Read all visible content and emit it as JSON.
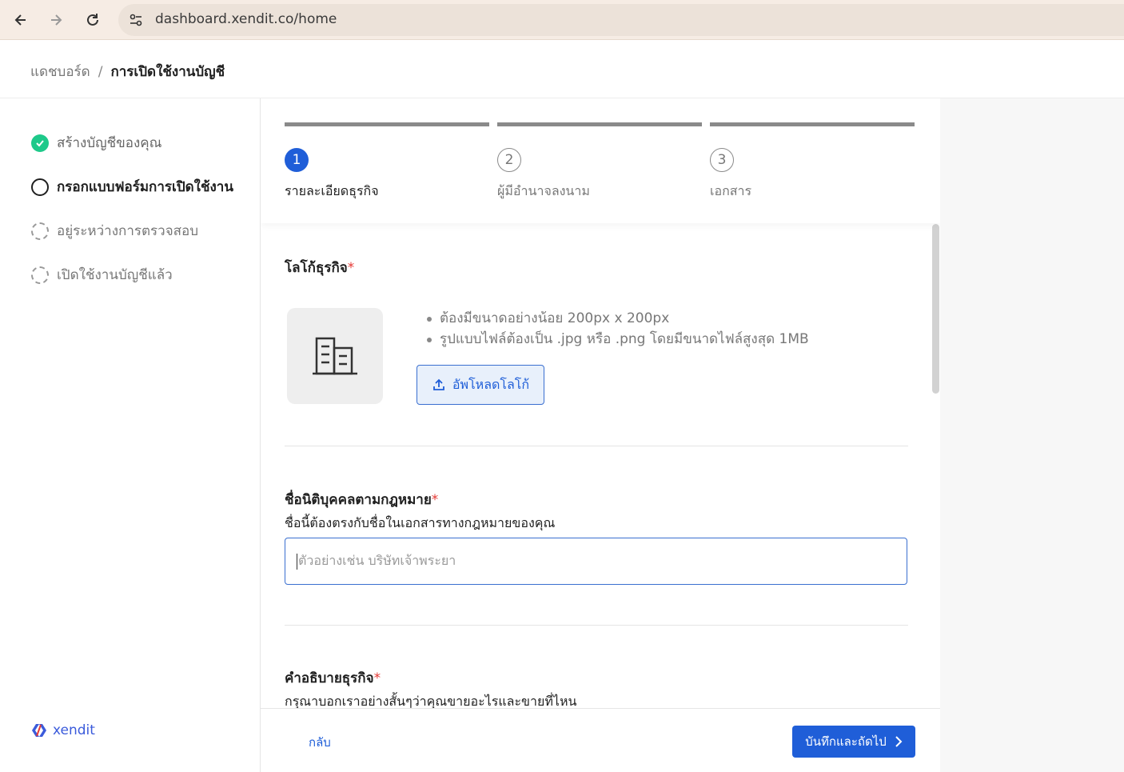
{
  "browser": {
    "url": "dashboard.xendit.co/home"
  },
  "breadcrumb": {
    "home": "แดชบอร์ด",
    "separator": "/",
    "current": "การเปิดใช้งานบัญชี"
  },
  "sidebar": {
    "steps": [
      {
        "label": "สร้างบัญชีของคุณ",
        "status": "done"
      },
      {
        "label": "กรอกแบบฟอร์มการเปิดใช้งาน",
        "status": "active"
      },
      {
        "label": "อยู่ระหว่างการตรวจสอบ",
        "status": "pending"
      },
      {
        "label": "เปิดใช้งานบัญชีแล้ว",
        "status": "pending"
      }
    ],
    "brand": "xendit"
  },
  "stepper": {
    "steps": [
      {
        "number": "1",
        "label": "รายละเอียดธุรกิจ",
        "status": "active"
      },
      {
        "number": "2",
        "label": "ผู้มีอำนาจลงนาม",
        "status": "idle"
      },
      {
        "number": "3",
        "label": "เอกสาร",
        "status": "idle"
      }
    ]
  },
  "form": {
    "logo": {
      "title": "โลโก้ธุรกิจ",
      "required_mark": "*",
      "requirements": [
        "ต้องมีขนาดอย่างน้อย 200px x 200px",
        "รูปแบบไฟล์ต้องเป็น .jpg หรือ .png โดยมีขนาดไฟล์สูงสุด 1MB"
      ],
      "upload_label": "อัพโหลดโลโก้"
    },
    "legal_name": {
      "title": "ชื่อนิติบุคคลตามกฎหมาย",
      "required_mark": "*",
      "help": "ชื่อนี้ต้องตรงกับชื่อในเอกสารทางกฎหมายของคุณ",
      "placeholder": "ตัวอย่างเช่น บริษัทเจ้าพระยา",
      "value": ""
    },
    "description": {
      "title": "คำอธิบายธุรกิจ",
      "required_mark": "*",
      "help": "กรุณาบอกเราอย่างสั้นๆว่าคุณขายอะไรและขายที่ไหน"
    }
  },
  "footer": {
    "back_label": "กลับ",
    "next_label": "บันทึกและถัดไป"
  },
  "colors": {
    "primary": "#1f5ed8",
    "success": "#1ec98a",
    "required": "#e53935"
  }
}
